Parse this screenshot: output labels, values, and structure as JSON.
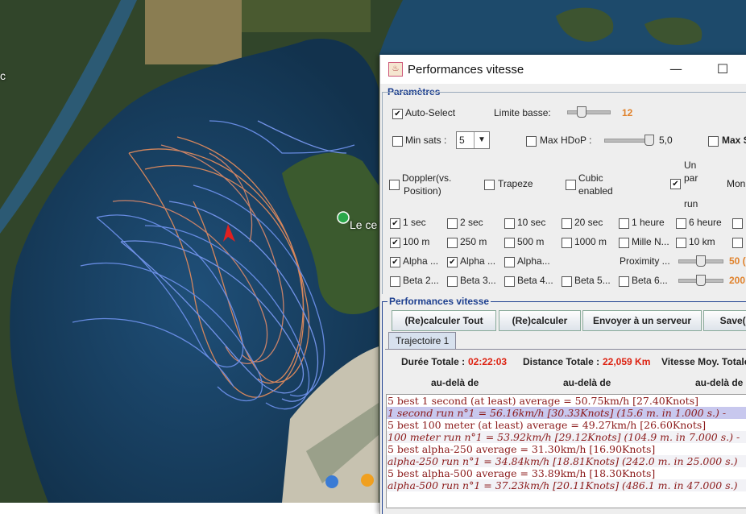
{
  "map": {
    "labels": [
      "c",
      "Le ce"
    ]
  },
  "window": {
    "title": "Performances vitesse",
    "minimize": "—",
    "maximize": "☐"
  },
  "parametres": {
    "legend": "Paramètres",
    "auto_select": "Auto-Select",
    "limite_basse": "Limite basse:",
    "limite_basse_value": "12",
    "min_sats": "Min sats :",
    "min_sats_value": "5",
    "max_hdop": "Max HDoP :",
    "max_hdop_value": "5,0",
    "max_s": "Max S",
    "doppler": "Doppler(vs.",
    "doppler2": "Position)",
    "trapeze": "Trapeze",
    "cubic": "Cubic",
    "cubic2": "enabled",
    "un": "Un",
    "par": "par",
    "run": "run",
    "mon": "Mon",
    "row1": [
      "1 sec",
      "2 sec",
      "10 sec",
      "20 sec",
      "1 heure",
      "6 heure"
    ],
    "row2": [
      "100 m",
      "250 m",
      "500 m",
      "1000 m",
      "Mille N...",
      "10 km"
    ],
    "row3": [
      "Alpha ...",
      "Alpha ...",
      "Alpha..."
    ],
    "proximity": "Proximity ...",
    "proximity_value": "50 (",
    "row4": [
      "Beta 2...",
      "Beta 3...",
      "Beta 4...",
      "Beta 5...",
      "Beta 6..."
    ],
    "beta_value": "200"
  },
  "perf": {
    "legend": "Performances vitesse",
    "btn_recalc_all": "(Re)calculer Tout",
    "btn_recalc": "(Re)calculer",
    "btn_send": "Envoyer à un serveur",
    "btn_save": "Save(H",
    "tab": "Trajectoire 1",
    "duree_label": "Durée Totale :",
    "duree_value": "02:22:03",
    "distance_label": "Distance Totale :",
    "distance_value": "22,059 Km",
    "vitesse_label": "Vitesse Moy. Totale",
    "col": [
      "au-delà de",
      "au-delà de",
      "au-delà de"
    ]
  },
  "results": [
    "5 best 1 second (at least) average = 50.75km/h [27.40Knots]",
    "1 second run n°1 = 56.16km/h [30.33Knots] (15.6 m. in 1.000 s.) -",
    "5 best 100 meter (at least) average = 49.27km/h [26.60Knots]",
    "100 meter run n°1 = 53.92km/h [29.12Knots] (104.9 m. in 7.000 s.) -",
    "5 best alpha-250 average = 31.30km/h [16.90Knots]",
    "alpha-250 run n°1 = 34.84km/h [18.81Knots] (242.0 m. in 25.000 s.)",
    "5 best alpha-500 average = 33.89km/h [18.30Knots]",
    "alpha-500 run n°1 = 37.23km/h [20.11Knots] (486.1 m. in 47.000 s.)"
  ]
}
